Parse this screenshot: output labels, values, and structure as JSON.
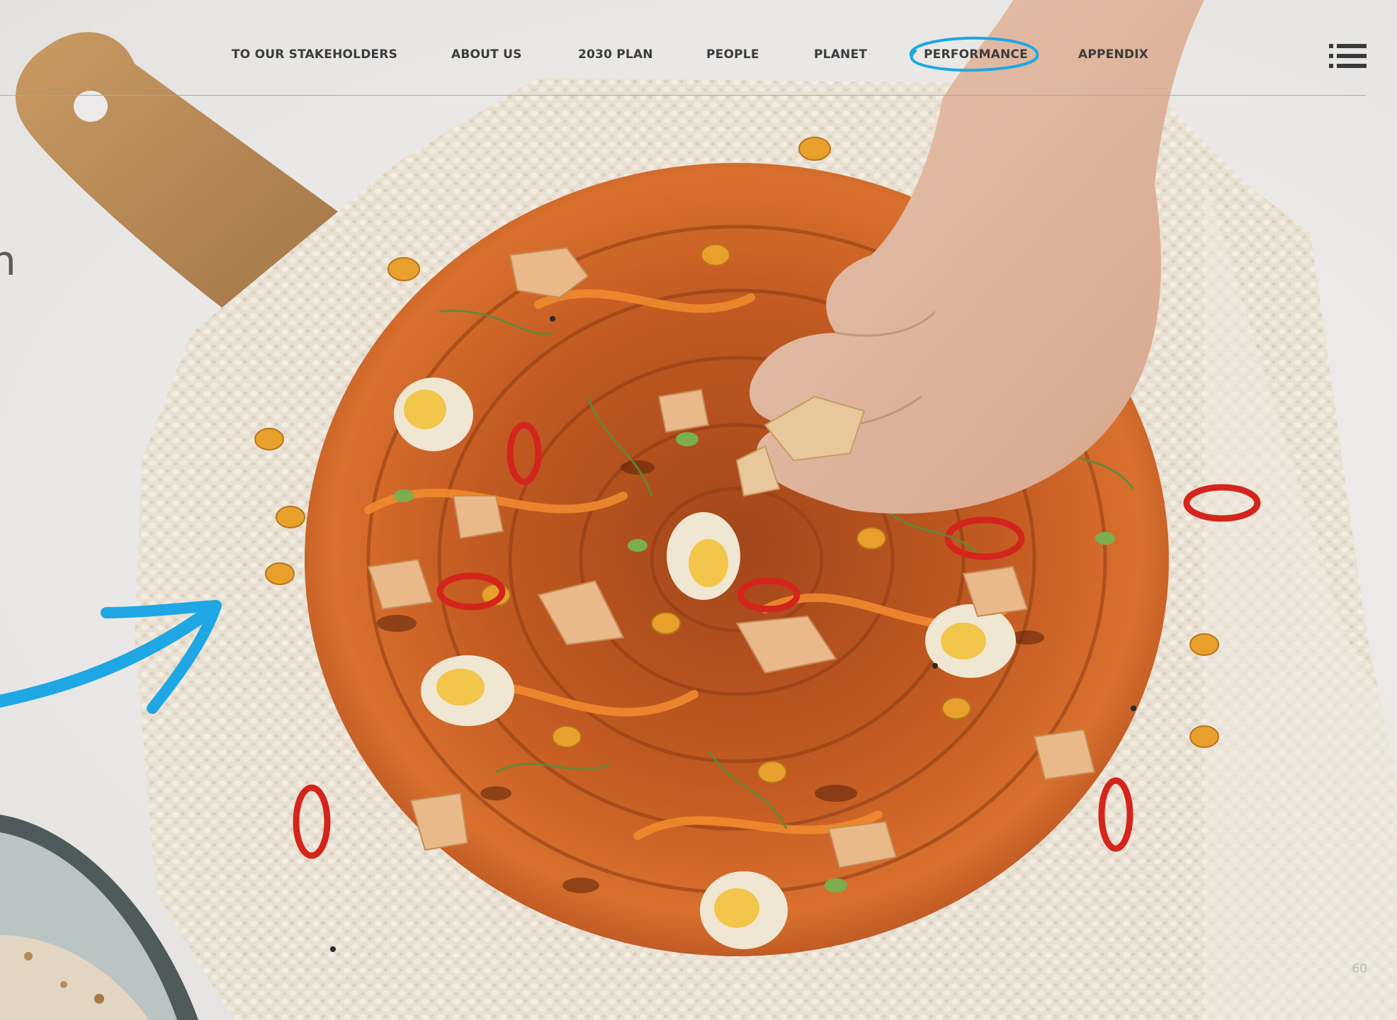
{
  "nav": {
    "items": [
      {
        "label": "TO OUR STAKEHOLDERS"
      },
      {
        "label": "ABOUT US"
      },
      {
        "label": "2030 PLAN"
      },
      {
        "label": "PEOPLE"
      },
      {
        "label": "PLANET"
      },
      {
        "label": "PERFORMANCE"
      },
      {
        "label": "APPENDIX"
      }
    ],
    "active": "PERFORMANCE",
    "menu_icon": "list-menu-icon"
  },
  "clipped_heading_fragment": "n",
  "page_number": "60",
  "colors": {
    "accent_blue": "#1ea7e4",
    "nav_text": "#3c3c3c",
    "background": "#ecebe9"
  }
}
